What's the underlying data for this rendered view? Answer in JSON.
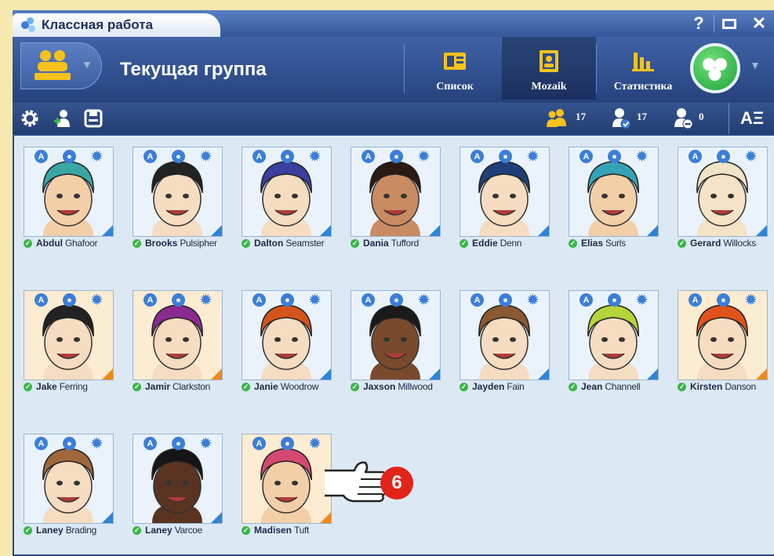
{
  "titlebar": {
    "title": "Классная работа",
    "help_label": "?",
    "restore_label": "□",
    "close_label": "✕"
  },
  "header": {
    "group_title": "Текущая группа",
    "tabs": [
      {
        "label": "Список",
        "icon": "list-card-icon"
      },
      {
        "label": "Mozaik",
        "icon": "mozaik-portrait-icon"
      },
      {
        "label": "Статистика",
        "icon": "bar-chart-icon"
      }
    ],
    "active_tab": "Mozaik"
  },
  "toolbar": {
    "total_count": "17",
    "present_count": "17",
    "absent_count": "0",
    "font_button": "AΞ"
  },
  "students": [
    {
      "first": "Abdul",
      "last": "Ghafoor",
      "bg": "#eaf3fc",
      "corner": "#2f84d8",
      "hair": "#3aa6a6",
      "skin": "#f3cfa8"
    },
    {
      "first": "Brooks",
      "last": "Pulsipher",
      "bg": "#eaf3fc",
      "corner": "#2f84d8",
      "hair": "#222222",
      "skin": "#f6dcc0"
    },
    {
      "first": "Dalton",
      "last": "Seamster",
      "bg": "#eaf3fc",
      "corner": "#2f84d8",
      "hair": "#3b3f9e",
      "skin": "#f6dcc0"
    },
    {
      "first": "Dania",
      "last": "Tufford",
      "bg": "#eaf3fc",
      "corner": "#2f84d8",
      "hair": "#2a1a12",
      "skin": "#c98b62"
    },
    {
      "first": "Eddie",
      "last": "Denn",
      "bg": "#eaf3fc",
      "corner": "#2f84d8",
      "hair": "#1f3f7a",
      "skin": "#f6dcc0"
    },
    {
      "first": "Elias",
      "last": "Surls",
      "bg": "#eaf3fc",
      "corner": "#2f84d8",
      "hair": "#35a3b6",
      "skin": "#f3cfa8"
    },
    {
      "first": "Gerard",
      "last": "Willocks",
      "bg": "#eaf3fc",
      "corner": "#2f84d8",
      "hair": "#f1e3c8",
      "skin": "#f6e2c6"
    },
    {
      "first": "Jake",
      "last": "Ferring",
      "bg": "#fcecd2",
      "corner": "#f08a1c",
      "hair": "#222222",
      "skin": "#f6dcc0"
    },
    {
      "first": "Jamir",
      "last": "Clarkston",
      "bg": "#fcecd2",
      "corner": "#f08a1c",
      "hair": "#8a2b8f",
      "skin": "#f6dcc0"
    },
    {
      "first": "Janie",
      "last": "Woodrow",
      "bg": "#eaf3fc",
      "corner": "#2f84d8",
      "hair": "#d4541c",
      "skin": "#f6dcc0"
    },
    {
      "first": "Jaxson",
      "last": "Millwood",
      "bg": "#eaf3fc",
      "corner": "#2f84d8",
      "hair": "#1a1a1a",
      "skin": "#7a4a2c"
    },
    {
      "first": "Jayden",
      "last": "Fain",
      "bg": "#eaf3fc",
      "corner": "#2f84d8",
      "hair": "#8a5a32",
      "skin": "#f6dcc0"
    },
    {
      "first": "Jean",
      "last": "Channell",
      "bg": "#eaf3fc",
      "corner": "#2f84d8",
      "hair": "#b6d43a",
      "skin": "#f6dcc0"
    },
    {
      "first": "Kirsten",
      "last": "Danson",
      "bg": "#fcecd2",
      "corner": "#f08a1c",
      "hair": "#e0541c",
      "skin": "#f6dcc0"
    },
    {
      "first": "Laney",
      "last": "Brading",
      "bg": "#eaf3fc",
      "corner": "#2f84d8",
      "hair": "#a0683a",
      "skin": "#f6dcc0"
    },
    {
      "first": "Laney",
      "last": "Varcoe",
      "bg": "#eaf3fc",
      "corner": "#2f84d8",
      "hair": "#151515",
      "skin": "#5a3420"
    },
    {
      "first": "Madisen",
      "last": "Tuft",
      "bg": "#fcecd2",
      "corner": "#f08a1c",
      "hair": "#d24a72",
      "skin": "#f3cfa8"
    }
  ],
  "callout": {
    "number": "6"
  }
}
